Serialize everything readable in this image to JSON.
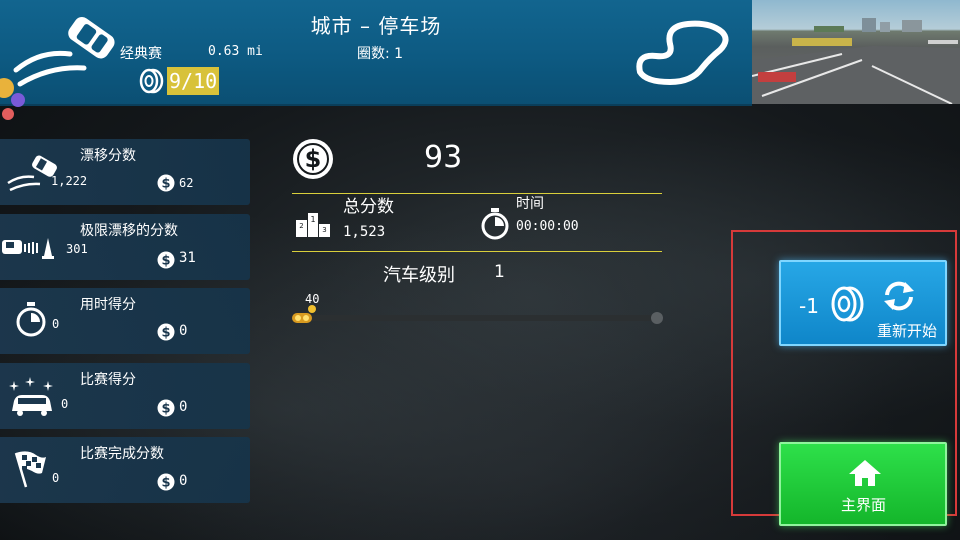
{
  "header": {
    "title": "城市 – 停车场",
    "race_type": "经典赛",
    "distance": "0.63 mi",
    "laps": "圈数: 1",
    "tires": "9/10"
  },
  "scores": [
    {
      "title": "漂移分数",
      "amount": "1,222",
      "reward": "62"
    },
    {
      "title": "极限漂移的分数",
      "amount": "301",
      "reward": "31"
    },
    {
      "title": "用时得分",
      "amount": "0",
      "reward": "0"
    },
    {
      "title": "比赛得分",
      "amount": "0",
      "reward": "0"
    },
    {
      "title": "比赛完成分数",
      "amount": "0",
      "reward": "0"
    }
  ],
  "summary": {
    "money": "93",
    "total_label": "总分数",
    "total_value": "1,523",
    "time_label": "时间",
    "time_value": "00:00:00",
    "car_level_label": "汽车级别",
    "car_level_value": "1",
    "progress_label": "40",
    "progress_fraction": 0.0
  },
  "buttons": {
    "restart_cost": "-1",
    "restart_label": "重新开始",
    "home_label": "主界面"
  },
  "colors": {
    "header_blue": "#0d5a82",
    "accent_yellow": "#d8c23a",
    "restart_blue": "#1a96d8",
    "home_green": "#1fc83a",
    "highlight_red": "#d63a3a"
  }
}
